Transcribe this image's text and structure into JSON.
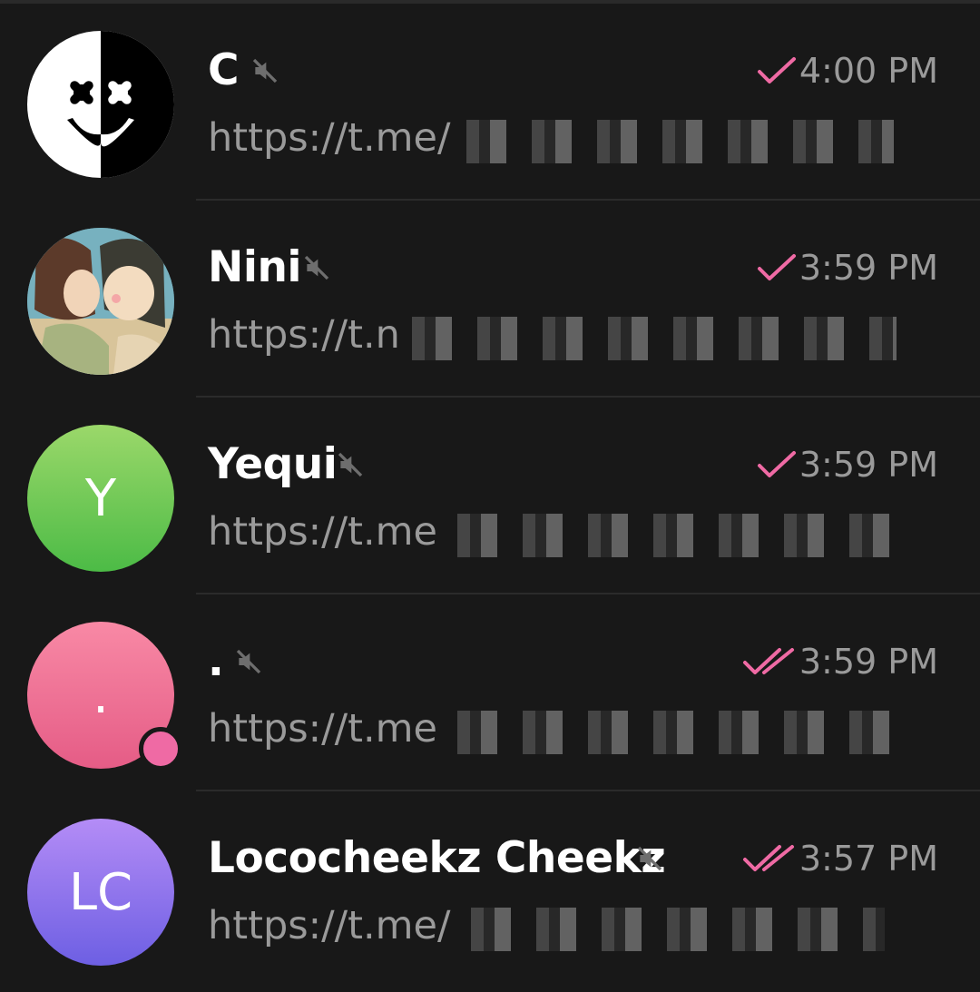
{
  "chats": [
    {
      "name": "C",
      "time": "4:00 PM",
      "preview": "https://t.me/",
      "status": "sent",
      "muted": true,
      "avatar": {
        "type": "image",
        "icon": "marshmello-face-icon"
      }
    },
    {
      "name": "Nini",
      "time": "3:59 PM",
      "preview": "https://t.n",
      "status": "sent",
      "muted": true,
      "avatar": {
        "type": "image",
        "icon": "anime-couple-photo"
      }
    },
    {
      "name": "Yequi",
      "time": "3:59 PM",
      "preview": "https://t.me",
      "status": "sent",
      "muted": true,
      "avatar": {
        "type": "initials",
        "initials": "Y",
        "color_top": "#9bd86a",
        "color_bottom": "#4cbb46"
      }
    },
    {
      "name": ".",
      "time": "3:59 PM",
      "preview": "https://t.me",
      "status": "read",
      "muted": true,
      "online": true,
      "avatar": {
        "type": "initials",
        "initials": ".",
        "color_top": "#f889a5",
        "color_bottom": "#e55c86"
      }
    },
    {
      "name": "Lococheekz Cheekz",
      "time": "3:57 PM",
      "preview": "https://t.me/",
      "status": "read",
      "muted": true,
      "avatar": {
        "type": "initials",
        "initials": "LC",
        "color_top": "#b48cf6",
        "color_bottom": "#6d5fe3"
      }
    }
  ],
  "colors": {
    "accent": "#ef6aa4",
    "muted_icon": "#6e6e6e",
    "text_secondary": "#9a9a9a"
  }
}
